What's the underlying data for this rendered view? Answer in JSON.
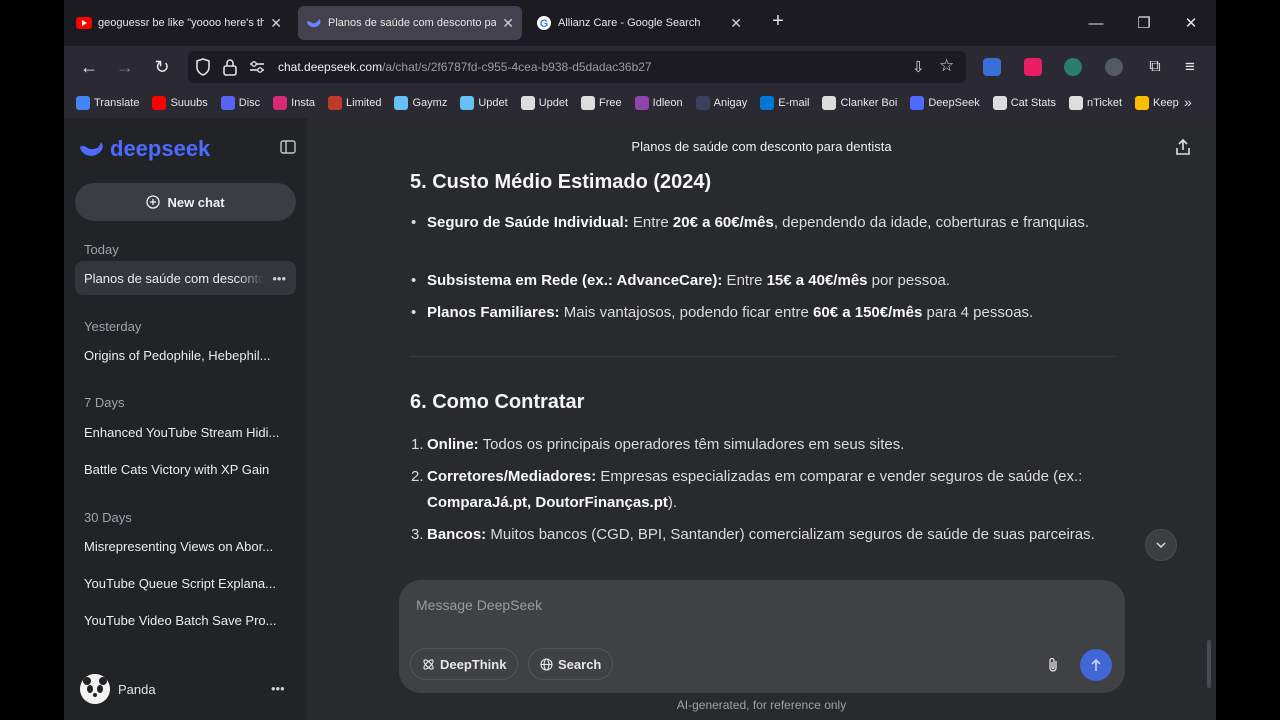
{
  "browser": {
    "tabs": [
      {
        "title": "geoguessr be like \"yoooo here's the m",
        "icon": "youtube-icon"
      },
      {
        "title": "Planos de saúde com desconto para d",
        "icon": "deepseek-icon",
        "active": true
      },
      {
        "title": "Allianz Care - Google Search",
        "icon": "google-icon"
      }
    ],
    "url_host": "chat.deepseek.com",
    "url_path": "/a/chat/s/2f6787fd-c955-4cea-b938-d5dadac36b27",
    "bookmarks": [
      {
        "label": "Translate",
        "color": "#4285f4"
      },
      {
        "label": "Suuubs",
        "color": "#ff0000"
      },
      {
        "label": "Disc",
        "color": "#5865f2"
      },
      {
        "label": "Insta",
        "color": "#d62976"
      },
      {
        "label": "Limited",
        "color": "#c0392b"
      },
      {
        "label": "Gaymz",
        "color": "#66c0f4"
      },
      {
        "label": "Updet",
        "color": "#66c0f4"
      },
      {
        "label": "Updet",
        "color": "#dddddd"
      },
      {
        "label": "Free",
        "color": "#dddddd"
      },
      {
        "label": "Idleon",
        "color": "#8e44ad"
      },
      {
        "label": "Anigay",
        "color": "#3d3d5c"
      },
      {
        "label": "E-mail",
        "color": "#0078d4"
      },
      {
        "label": "Clanker Boi",
        "color": "#dddddd"
      },
      {
        "label": "DeepSeek",
        "color": "#4d6bfe"
      },
      {
        "label": "Cat Stats",
        "color": "#dddddd"
      },
      {
        "label": "nTicket",
        "color": "#dddddd"
      },
      {
        "label": "Keep",
        "color": "#fbbc04"
      }
    ]
  },
  "sidebar": {
    "brand": "deepseek",
    "new_chat": "New chat",
    "groups": [
      {
        "label": "Today",
        "items": [
          "Planos de saúde com desconto para dentista"
        ]
      },
      {
        "label": "Yesterday",
        "items": [
          "Origins of Pedophile, Hebephil..."
        ]
      },
      {
        "label": "7 Days",
        "items": [
          "Enhanced YouTube Stream Hidi...",
          "Battle Cats Victory with XP Gain"
        ]
      },
      {
        "label": "30 Days",
        "items": [
          "Misrepresenting Views on Abor...",
          "YouTube Queue Script Explana...",
          "YouTube Video Batch Save Pro..."
        ]
      }
    ],
    "user": "Panda"
  },
  "main": {
    "title": "Planos de saúde com desconto para dentista",
    "section5": {
      "heading": "5. Custo Médio Estimado (2024)",
      "items": [
        {
          "b1": "Seguro de Saúde Individual:",
          "t1": " Entre ",
          "b2": "20€ a 60€/mês",
          "t2": ", dependendo da idade, coberturas e franquias."
        },
        {
          "b1": "Subsistema em Rede (ex.: AdvanceCare):",
          "t1": " Entre ",
          "b2": "15€ a 40€/mês",
          "t2": " por pessoa."
        },
        {
          "b1": "Planos Familiares:",
          "t1": " Mais vantajosos, podendo ficar entre ",
          "b2": "60€ a 150€/mês",
          "t2": " para 4 pessoas."
        }
      ]
    },
    "section6": {
      "heading": "6. Como Contratar",
      "items": [
        {
          "num": "1.",
          "b1": "Online:",
          "t1": " Todos os principais operadores têm simuladores em seus sites."
        },
        {
          "num": "2.",
          "b1": "Corretores/Mediadores:",
          "t1": " Empresas especializadas em comparar e vender seguros de saúde (ex.: ",
          "b2": "ComparaJá.pt, DoutorFinanças.pt",
          "t2": ")."
        },
        {
          "num": "3.",
          "b1": "Bancos:",
          "t1": " Muitos bancos (CGD, BPI, Santander) comercializam seguros de saúde de suas parceiras."
        }
      ]
    },
    "composer": {
      "placeholder": "Message DeepSeek",
      "deepthink": "DeepThink",
      "search": "Search"
    },
    "disclaimer": "AI-generated, for reference only"
  },
  "colors": {
    "accent": "#4d6bfe",
    "send": "#4166d5"
  }
}
